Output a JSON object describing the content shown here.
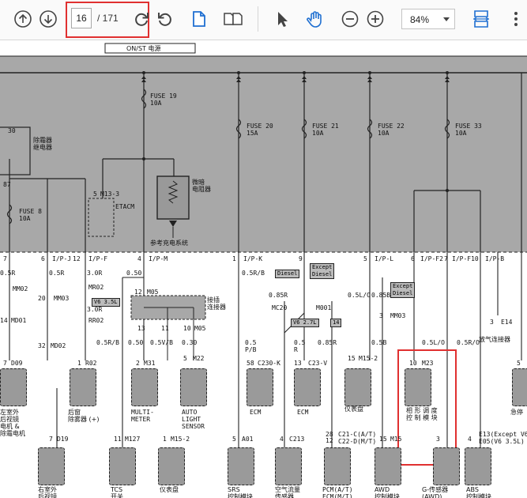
{
  "toolbar": {
    "current_page": "16",
    "total_pages": "/ 171",
    "zoom": "84%"
  },
  "diagram": {
    "top_bus_label": "ON/ST 电源",
    "fuses": [
      {
        "name": "FUSE 19",
        "amp": "10A"
      },
      {
        "name": "FUSE 20",
        "amp": "15A"
      },
      {
        "name": "FUSE 21",
        "amp": "10A"
      },
      {
        "name": "FUSE 22",
        "amp": "10A"
      },
      {
        "name": "FUSE 33",
        "amp": "10A"
      },
      {
        "name": "FUSE 8",
        "amp": "10A"
      }
    ],
    "labels": {
      "defog_relay": "除霜器\n继电器",
      "n30": "30",
      "n87": "87",
      "m13_5": "5",
      "m13": "M13-3",
      "etacm": "ETACM",
      "dim_relay": "微暗\n电阻器",
      "ref_charge": "参考充电系统",
      "ip_j": "I/P-J",
      "ip_j_n": "12",
      "ip_f": "I/P-F",
      "ip_m": "I/P-M",
      "ip_k": "I/P-K",
      "ip_l": "I/P-L",
      "ip_f2": "I/P-F2",
      "ip_f10": "I/P-F10",
      "ip_b": "I/P-B",
      "n7": "7",
      "n6": "6",
      "n4": "4",
      "n1": "1",
      "n9": "9",
      "n5": "5",
      "n6b": "6",
      "n7b": "7",
      "w05r": "0.5R",
      "w05r_b": "0.5R",
      "w30r": "3.0R",
      "w30r_b": "3.0R",
      "w050": "0.50",
      "w05rb": "0.5R/B",
      "mm02": "MM02",
      "mm03": "MM03",
      "n20": "20",
      "n14": "14",
      "md01": "MD01",
      "md02": "MD02",
      "n32": "32",
      "mr02": "MR02",
      "rr02": "RR02",
      "v6_3_5l": "V6 3.5L",
      "m05": "M05",
      "n12": "12",
      "joint": "接插\n连接器",
      "n13": "13",
      "n11": "11",
      "n10": "10",
      "diesel": "Diesel",
      "except_diesel": "Except\nDiesel",
      "mc20": "MC20",
      "m001": "M001",
      "v6_2_7l": "V6 2.7L",
      "n14b": "14",
      "w05rb2": "0.5R/B",
      "w050b": "0.50",
      "w05vb": "0.5V/B",
      "w030": "0.30",
      "w05pb": "0.5\nP/B",
      "w05r3": "0.5\nR",
      "w085r": "0.85R",
      "w05lo": "0.5L/O",
      "w085b": "0.85B",
      "w05bl": "0.5B",
      "w05blo": "0.5L/O",
      "w05ro": "0.5R/O",
      "except_diesel2": "Except\nDiesel",
      "n3": "3",
      "mm03b": "MM03",
      "n7c": "7",
      "d09": "D09",
      "r02": "R02",
      "n2": "2",
      "m31": "M31",
      "n5b": "5",
      "m22": "M22",
      "n58": "58",
      "c230k": "C230-K",
      "n13b": "13",
      "c23v": "C23-V",
      "n15": "15",
      "m152": "M15-2",
      "n10b": "10",
      "m23": "M23",
      "e14": "E14",
      "n3b": "3",
      "exhaust_joint": "放气连接器",
      "n5c": "5",
      "rear_defog": "后窗\n除雾器 (+)",
      "left_mirror": "左室外\n后视镜\n电机 &\n除霜电机",
      "multi_meter": "MULTI-\nMETER",
      "auto_light": "AUTO\nLIGHT\nSENSOR",
      "ecm1": "ECM",
      "ecm2": "ECM",
      "cluster": "仪表盘",
      "headlamp_module": "相 形 调 度\n控 制 模 块",
      "tcs": "TCS\n开关",
      "cluster2": "仪表盘",
      "d19": "D19",
      "n7d": "7",
      "m127": "M127",
      "n11b": "11",
      "m152b": "M15-2",
      "n5d": "5",
      "a01": "A01",
      "n4b": "4",
      "c213": "C213",
      "n28": "28",
      "n12b": "12",
      "c21c": "C21-C(A/T)\nC22-D(M/T)",
      "n15b": "15",
      "m15": "M15",
      "n3c": "3",
      "n4c": "4",
      "e13": "E13(Except V6\nE05(V6 3.5L)",
      "right_mirror": "右室外\n后视镜",
      "srs": "SRS\n控制模块",
      "airflow": "空气流量\n传感器",
      "pcm": "PCM(A/T)\nECM(M/T)",
      "awd": "AWD\n控制模块",
      "gsensor": "G-传感器\n(AWD)",
      "abs": "ABS\n控制模块",
      "fog_side": "急停"
    }
  }
}
